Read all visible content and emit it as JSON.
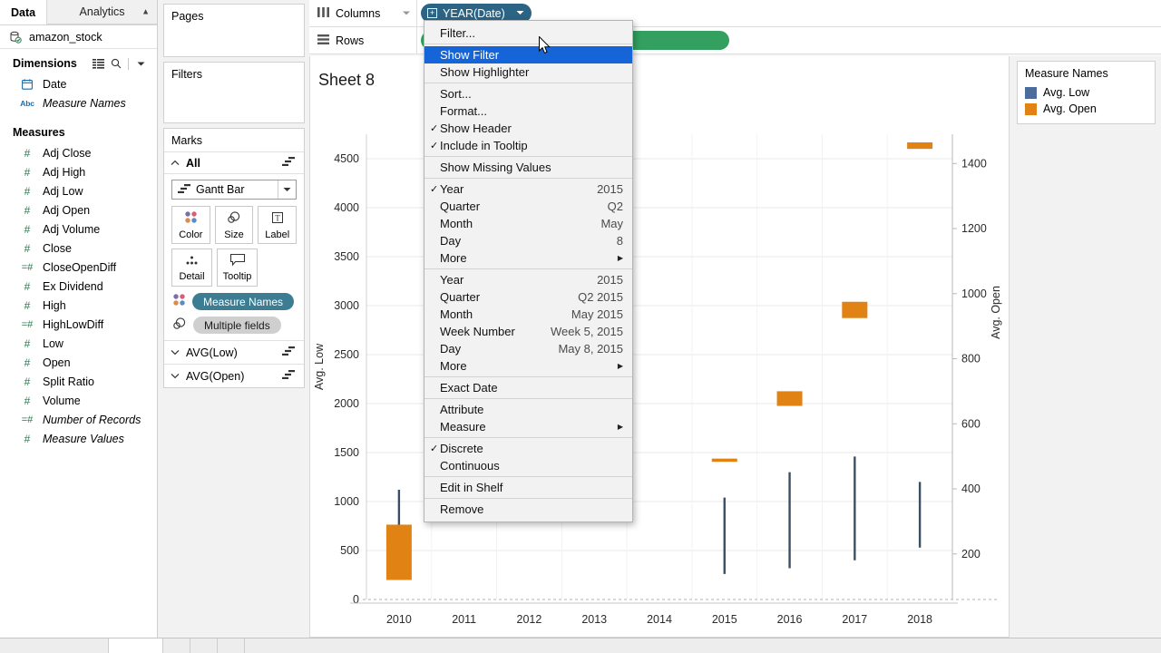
{
  "left_pane": {
    "tabs": [
      {
        "label": "Data",
        "active": true
      },
      {
        "label": "Analytics",
        "active": false
      }
    ],
    "datasource": {
      "label": "amazon_stock",
      "icon": "database-icon"
    },
    "dimensions": {
      "header": "Dimensions",
      "items": [
        {
          "label": "Date",
          "icon": "calendar-icon",
          "italic": false
        },
        {
          "label": "Measure Names",
          "icon": "abc-icon",
          "italic": true
        }
      ]
    },
    "measures": {
      "header": "Measures",
      "items": [
        {
          "label": "Adj Close",
          "icon": "number-icon",
          "italic": false
        },
        {
          "label": "Adj High",
          "icon": "number-icon",
          "italic": false
        },
        {
          "label": "Adj Low",
          "icon": "number-icon",
          "italic": false
        },
        {
          "label": "Adj Open",
          "icon": "number-icon",
          "italic": false
        },
        {
          "label": "Adj Volume",
          "icon": "number-icon",
          "italic": false
        },
        {
          "label": "Close",
          "icon": "number-icon",
          "italic": false
        },
        {
          "label": "CloseOpenDiff",
          "icon": "calculated-number-icon",
          "italic": false
        },
        {
          "label": "Ex Dividend",
          "icon": "number-icon",
          "italic": false
        },
        {
          "label": "High",
          "icon": "number-icon",
          "italic": false
        },
        {
          "label": "HighLowDiff",
          "icon": "calculated-number-icon",
          "italic": false
        },
        {
          "label": "Low",
          "icon": "number-icon",
          "italic": false
        },
        {
          "label": "Open",
          "icon": "number-icon",
          "italic": false
        },
        {
          "label": "Split Ratio",
          "icon": "number-icon",
          "italic": false
        },
        {
          "label": "Volume",
          "icon": "number-icon",
          "italic": false
        },
        {
          "label": "Number of Records",
          "icon": "calculated-number-icon",
          "italic": true
        },
        {
          "label": "Measure Values",
          "icon": "number-icon",
          "italic": true
        }
      ]
    }
  },
  "shelves": {
    "pages_title": "Pages",
    "filters_title": "Filters",
    "marks_title": "Marks",
    "marks_all_label": "All",
    "mark_type": "Gantt Bar",
    "properties": [
      {
        "label": "Color",
        "icon": "color-dots-icon"
      },
      {
        "label": "Size",
        "icon": "size-circle-icon"
      },
      {
        "label": "Label",
        "icon": "label-text-icon"
      },
      {
        "label": "Detail",
        "icon": "detail-dots-icon"
      },
      {
        "label": "Tooltip",
        "icon": "tooltip-bubble-icon"
      }
    ],
    "encodings": [
      {
        "label": "Measure Names",
        "icon": "color-dots-icon",
        "style": "blue"
      },
      {
        "label": "Multiple fields",
        "icon": "size-circle-icon",
        "style": "gray"
      }
    ],
    "sub_cards": [
      {
        "label": "AVG(Low)"
      },
      {
        "label": "AVG(Open)"
      }
    ]
  },
  "top_shelves": {
    "columns_label": "Columns",
    "rows_label": "Rows",
    "columns_pill": "YEAR(Date)",
    "rows_pill": ""
  },
  "view": {
    "sheet_title": "Sheet 8"
  },
  "legend": {
    "title": "Measure Names",
    "items": [
      {
        "label": "Avg. Low",
        "color": "#4c6c9c"
      },
      {
        "label": "Avg. Open",
        "color": "#e08214"
      }
    ]
  },
  "context_menu": {
    "groups": [
      {
        "items": [
          {
            "label": "Filter...",
            "checked": false,
            "value": "",
            "submenu": false,
            "selected": false
          }
        ]
      },
      {
        "items": [
          {
            "label": "Show Filter",
            "checked": false,
            "value": "",
            "submenu": false,
            "selected": true
          },
          {
            "label": "Show Highlighter",
            "checked": false,
            "value": "",
            "submenu": false,
            "selected": false
          }
        ]
      },
      {
        "items": [
          {
            "label": "Sort...",
            "checked": false,
            "value": "",
            "submenu": false,
            "selected": false
          },
          {
            "label": "Format...",
            "checked": false,
            "value": "",
            "submenu": false,
            "selected": false
          },
          {
            "label": "Show Header",
            "checked": true,
            "value": "",
            "submenu": false,
            "selected": false
          },
          {
            "label": "Include in Tooltip",
            "checked": true,
            "value": "",
            "submenu": false,
            "selected": false
          }
        ]
      },
      {
        "items": [
          {
            "label": "Show Missing Values",
            "checked": false,
            "value": "",
            "submenu": false,
            "selected": false
          }
        ]
      },
      {
        "items": [
          {
            "label": "Year",
            "checked": true,
            "value": "2015",
            "submenu": false,
            "selected": false
          },
          {
            "label": "Quarter",
            "checked": false,
            "value": "Q2",
            "submenu": false,
            "selected": false
          },
          {
            "label": "Month",
            "checked": false,
            "value": "May",
            "submenu": false,
            "selected": false
          },
          {
            "label": "Day",
            "checked": false,
            "value": "8",
            "submenu": false,
            "selected": false
          },
          {
            "label": "More",
            "checked": false,
            "value": "",
            "submenu": true,
            "selected": false
          }
        ]
      },
      {
        "items": [
          {
            "label": "Year",
            "checked": false,
            "value": "2015",
            "submenu": false,
            "selected": false
          },
          {
            "label": "Quarter",
            "checked": false,
            "value": "Q2 2015",
            "submenu": false,
            "selected": false
          },
          {
            "label": "Month",
            "checked": false,
            "value": "May 2015",
            "submenu": false,
            "selected": false
          },
          {
            "label": "Week Number",
            "checked": false,
            "value": "Week 5, 2015",
            "submenu": false,
            "selected": false
          },
          {
            "label": "Day",
            "checked": false,
            "value": "May 8, 2015",
            "submenu": false,
            "selected": false
          },
          {
            "label": "More",
            "checked": false,
            "value": "",
            "submenu": true,
            "selected": false
          }
        ]
      },
      {
        "items": [
          {
            "label": "Exact Date",
            "checked": false,
            "value": "",
            "submenu": false,
            "selected": false
          }
        ]
      },
      {
        "items": [
          {
            "label": "Attribute",
            "checked": false,
            "value": "",
            "submenu": false,
            "selected": false
          },
          {
            "label": "Measure",
            "checked": false,
            "value": "",
            "submenu": true,
            "selected": false
          }
        ]
      },
      {
        "items": [
          {
            "label": "Discrete",
            "checked": true,
            "value": "",
            "submenu": false,
            "selected": false
          },
          {
            "label": "Continuous",
            "checked": false,
            "value": "",
            "submenu": false,
            "selected": false
          }
        ]
      },
      {
        "items": [
          {
            "label": "Edit in Shelf",
            "checked": false,
            "value": "",
            "submenu": false,
            "selected": false
          }
        ]
      },
      {
        "items": [
          {
            "label": "Remove",
            "checked": false,
            "value": "",
            "submenu": false,
            "selected": false
          }
        ]
      }
    ]
  },
  "chart_data": {
    "type": "bar",
    "title": "Sheet 8",
    "xlabel": "",
    "ylabel": "Avg. Low",
    "y2label": "Avg. Open",
    "grid": true,
    "categories": [
      "2010",
      "2011",
      "2012",
      "2013",
      "2014",
      "2015",
      "2016",
      "2017",
      "2018"
    ],
    "left_axis": {
      "label": "Avg. Low",
      "ticks": [
        0,
        500,
        1000,
        1500,
        2000,
        2500,
        3000,
        3500,
        4000,
        4500
      ],
      "ylim": [
        0,
        4750
      ]
    },
    "right_axis": {
      "label": "Avg. Open",
      "ticks": [
        200,
        400,
        600,
        800,
        1000,
        1200,
        1400
      ],
      "ylim": [
        60,
        1490
      ]
    },
    "series": [
      {
        "name": "Avg. Low",
        "color": "#3a4f63",
        "type": "gantt-line",
        "note": "vertical line marks, values read on the left Avg. Low axis",
        "values": [
          {
            "category": "2010",
            "low": 200,
            "high": 1120
          },
          {
            "category": "2011",
            "low": null,
            "high": null
          },
          {
            "category": "2012",
            "low": null,
            "high": null
          },
          {
            "category": "2013",
            "low": null,
            "high": null
          },
          {
            "category": "2014",
            "low": null,
            "high": null
          },
          {
            "category": "2015",
            "low": 260,
            "high": 1040
          },
          {
            "category": "2016",
            "low": 320,
            "high": 1300
          },
          {
            "category": "2017",
            "low": 400,
            "high": 1460
          },
          {
            "category": "2018",
            "low": 530,
            "high": 1200
          }
        ]
      },
      {
        "name": "Avg. Open",
        "color": "#e08214",
        "type": "gantt-bar",
        "note": "orange Gantt bars, values read on the right Avg. Open axis",
        "values": [
          {
            "category": "2010",
            "start": 120,
            "end": 290
          },
          {
            "category": "2011",
            "start": null,
            "end": null
          },
          {
            "category": "2012",
            "start": null,
            "end": null
          },
          {
            "category": "2013",
            "start": null,
            "end": null
          },
          {
            "category": "2014",
            "start": null,
            "end": null
          },
          {
            "category": "2015",
            "start": 487,
            "end": 493
          },
          {
            "category": "2016",
            "start": 655,
            "end": 700
          },
          {
            "category": "2017",
            "start": 925,
            "end": 975
          },
          {
            "category": "2018",
            "start": 1445,
            "end": 1465
          }
        ]
      }
    ]
  }
}
